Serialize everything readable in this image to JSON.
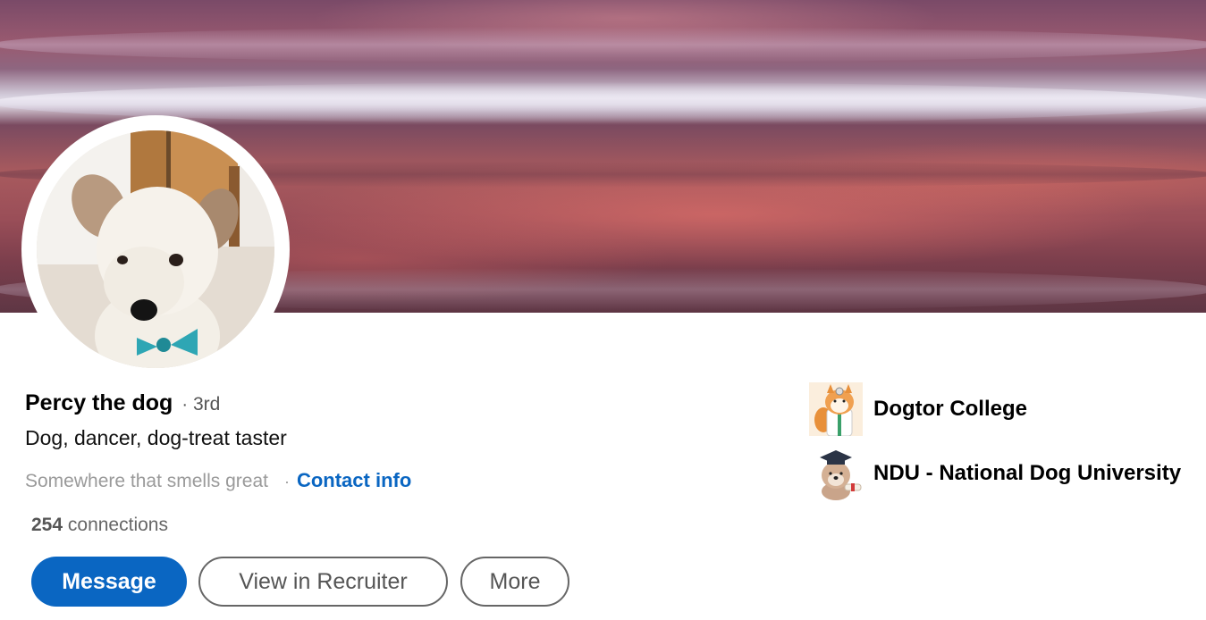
{
  "profile": {
    "name": "Percy the dog",
    "degree_separator": "·",
    "degree": "3rd",
    "headline": "Dog, dancer, dog-treat taster",
    "location": "Somewhere that smells great",
    "location_separator": "·",
    "contact_info_label": "Contact info",
    "connections_count": "254",
    "connections_label": "connections"
  },
  "actions": {
    "message_label": "Message",
    "recruiter_label": "View in Recruiter",
    "more_label": "More"
  },
  "education": [
    {
      "name": "Dogtor College",
      "logo": "cartoon-dog-doctor-logo"
    },
    {
      "name": "NDU - National Dog University",
      "logo": "cartoon-dog-graduate-logo"
    }
  ],
  "colors": {
    "primary": "#0a66c2",
    "link": "#0a66c2",
    "muted_text": "#9a9a9a"
  }
}
